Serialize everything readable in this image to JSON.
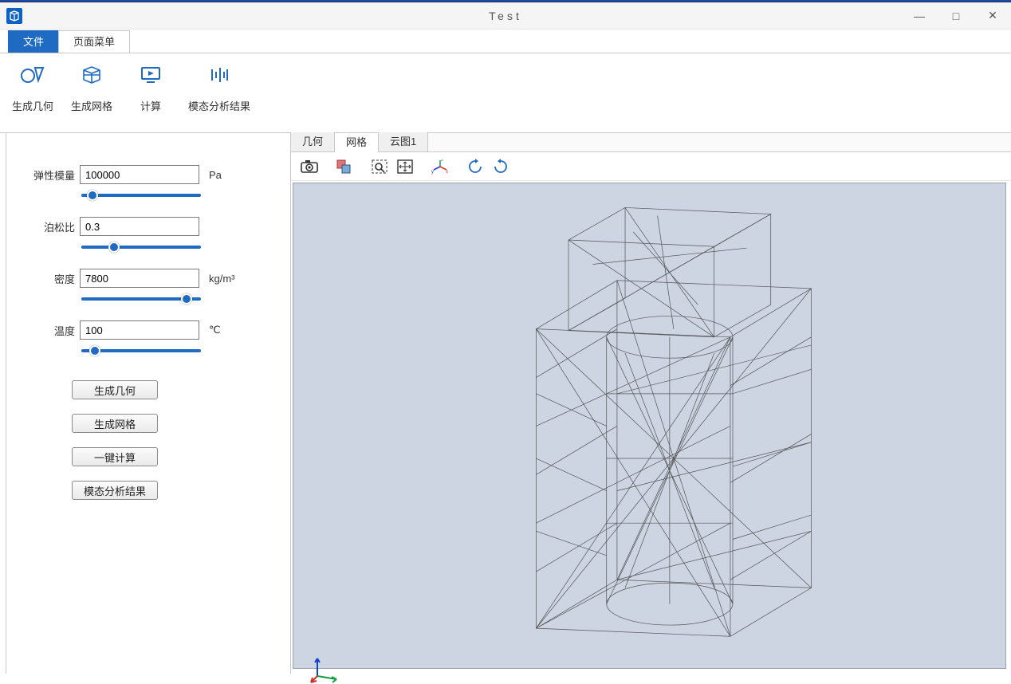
{
  "window": {
    "title": "Test",
    "controls": {
      "min": "—",
      "max": "□",
      "close": "✕"
    }
  },
  "tabs": {
    "file": "文件",
    "page_menu": "页面菜单"
  },
  "ribbon": {
    "items": [
      {
        "id": "geom",
        "label": "生成几何"
      },
      {
        "id": "mesh",
        "label": "生成网格"
      },
      {
        "id": "calc",
        "label": "计算"
      },
      {
        "id": "modal",
        "label": "模态分析结果"
      }
    ]
  },
  "params": {
    "elastic_modulus": {
      "label": "弹性模量",
      "value": "100000",
      "unit": "Pa",
      "slider": 5
    },
    "poisson_ratio": {
      "label": "泊松比",
      "value": "0.3",
      "unit": "",
      "slider": 25
    },
    "density": {
      "label": "密度",
      "value": "7800",
      "unit": "kg/m³",
      "slider": 92
    },
    "temperature": {
      "label": "温度",
      "value": "100",
      "unit": "℃",
      "slider": 7
    }
  },
  "actions": {
    "gen_geom": "生成几何",
    "gen_mesh": "生成网格",
    "one_calc": "一键计算",
    "modal_res": "模态分析结果"
  },
  "view": {
    "tabs": [
      {
        "id": "geom",
        "label": "几何"
      },
      {
        "id": "mesh",
        "label": "网格"
      },
      {
        "id": "cloud",
        "label": "云图1"
      }
    ],
    "active_tab": "mesh",
    "toolbar_icons": [
      "camera-icon",
      "object-select-icon",
      "zoom-box-icon",
      "fit-view-icon",
      "axes-icon",
      "rotate-ccw-icon",
      "rotate-cw-icon"
    ],
    "axis_labels": {
      "x": "x",
      "y": "y",
      "z": "z"
    }
  }
}
